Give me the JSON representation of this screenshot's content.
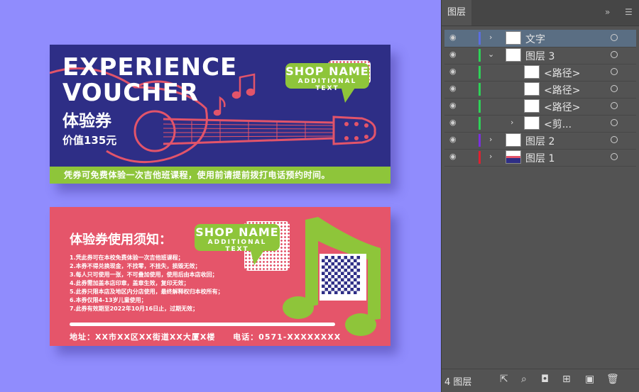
{
  "voucher1": {
    "title_line1": "EXPERIENCE",
    "title_line2": "VOUCHER",
    "title_cn": "体验券",
    "value": "价值135元",
    "bubble_name": "SHOP NAME",
    "bubble_sub": "ADDITIONAL TEXT",
    "bottom_text": "凭券可免费体验一次吉他班课程，使用前请提前拨打电话预约时间。"
  },
  "voucher2": {
    "notice_title": "体验券使用须知：",
    "bubble_name": "SHOP NAME",
    "bubble_sub": "ADDITIONAL TEXT",
    "rules": [
      "1.凭此券可在本校免费体验一次吉他班课程；",
      "2.本券不得兑换现金，不找零，不挂失，损毁无效；",
      "3.每人只可使用一张，不可叠加使用，使用后由本店收回；",
      "4.此券需加盖本店印章，盖章生效，复印无效；",
      "5.此券只限本店及地区内分店使用，最终解释权归本校所有；",
      "6.本券仅限4-13岁儿童使用；",
      "7.此券有效期至2022年10月16日止，过期无效；"
    ],
    "address": "地址：XX市XX区XX街道XX大厦X楼",
    "phone": "电话：0571-XXXXXXXX"
  },
  "panel": {
    "tab_label": "图层",
    "layers": [
      {
        "label": "文字",
        "color": "#5b6ee1"
      },
      {
        "label": "图层 3",
        "color": "#2ed158"
      },
      {
        "label": "<路径>",
        "color": "#2ed158"
      },
      {
        "label": "<路径>",
        "color": "#2ed158"
      },
      {
        "label": "<路径>",
        "color": "#2ed158"
      },
      {
        "label": "<剪...",
        "color": "#2ed158"
      },
      {
        "label": "图层 2",
        "color": "#7a2fe0"
      },
      {
        "label": "图层 1",
        "color": "#e02030"
      }
    ],
    "count": "4 图层"
  }
}
